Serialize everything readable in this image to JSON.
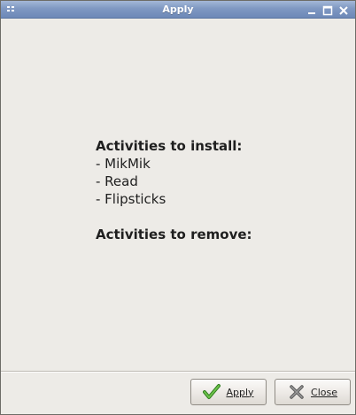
{
  "window": {
    "title": "Apply"
  },
  "icons": {
    "menu": "window-menu-icon",
    "minimize": "minimize-icon",
    "maximize": "maximize-icon",
    "close": "close-x-icon",
    "apply": "checkmark-icon",
    "close_button": "x-icon"
  },
  "content": {
    "install_heading": "Activities to install:",
    "install_items": [
      "- MikMik",
      "- Read",
      "- Flipsticks"
    ],
    "remove_heading": "Activities to remove:"
  },
  "buttons": {
    "apply_label": "Apply",
    "close_label": "Close"
  },
  "colors": {
    "titlebar": "#7f98c2",
    "background": "#edebe7",
    "check": "#3f9b2a"
  }
}
